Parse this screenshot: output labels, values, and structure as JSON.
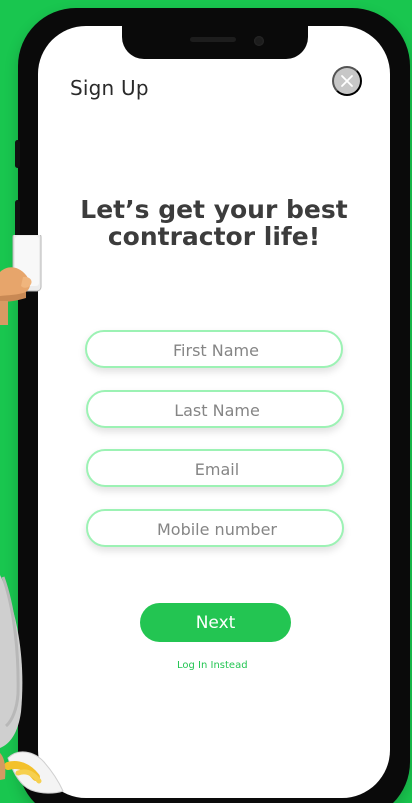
{
  "screen": {
    "title": "Sign Up",
    "headline_line1": "Let’s get your best",
    "headline_line2": "contractor life!"
  },
  "close": {
    "icon": "close-icon"
  },
  "form": {
    "first_name_placeholder": "First Name",
    "last_name_placeholder": "Last Name",
    "email_placeholder": "Email",
    "mobile_placeholder": "Mobile number"
  },
  "actions": {
    "next_label": "Next",
    "login_label": "Log In Instead"
  },
  "colors": {
    "background": "#19c64f",
    "accent": "#23c552",
    "field_border": "#9cf2b4"
  },
  "illustration": {
    "subject": "3D character holding phone"
  }
}
